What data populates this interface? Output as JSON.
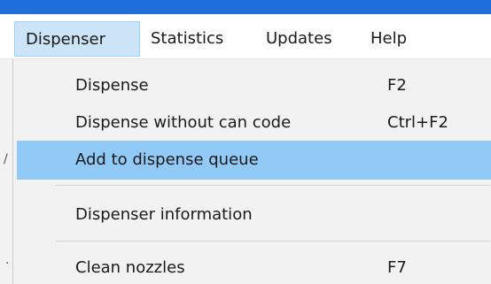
{
  "menubar": {
    "items": [
      {
        "label": "Dispenser"
      },
      {
        "label": "Statistics"
      },
      {
        "label": "Updates"
      },
      {
        "label": "Help"
      }
    ]
  },
  "dropdown": {
    "items": [
      {
        "label": "Dispense",
        "shortcut": "F2"
      },
      {
        "label": "Dispense without can code",
        "shortcut": "Ctrl+F2"
      },
      {
        "label": "Add to dispense queue",
        "shortcut": ""
      },
      {
        "label": "Dispenser information",
        "shortcut": ""
      },
      {
        "label": "Clean nozzles",
        "shortcut": "F7"
      }
    ]
  },
  "colors": {
    "accent": "#1e6fd9",
    "highlight": "#91c9f7",
    "active_menu": "#cce4f7"
  }
}
